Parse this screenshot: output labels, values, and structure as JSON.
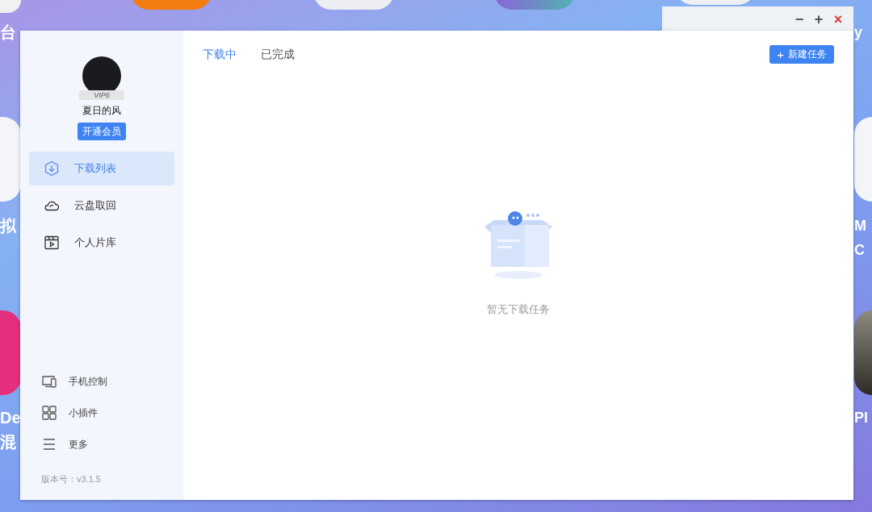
{
  "desktop": {
    "left_labels": [
      "台",
      "拟",
      "De",
      "混"
    ],
    "right_labels": [
      "y",
      "M",
      "C",
      "Pl"
    ]
  },
  "window": {
    "controls": [
      "−",
      "+",
      "×"
    ]
  },
  "profile": {
    "name": "夏日的风",
    "badge": "VIP6",
    "vip_button": "开通会员"
  },
  "nav": [
    {
      "label": "下载列表",
      "selected": true
    },
    {
      "label": "云盘取回",
      "selected": false
    },
    {
      "label": "个人片库",
      "selected": false
    }
  ],
  "bottom_nav": [
    "手机控制",
    "小插件",
    "更多"
  ],
  "version": "版本号：v3.1.5",
  "tabs": [
    {
      "label": "下载中",
      "selected": true
    },
    {
      "label": "已完成",
      "selected": false
    }
  ],
  "new_task_button": {
    "icon": "+",
    "label": "新建任务"
  },
  "empty_state": {
    "message": "暂无下载任务"
  }
}
